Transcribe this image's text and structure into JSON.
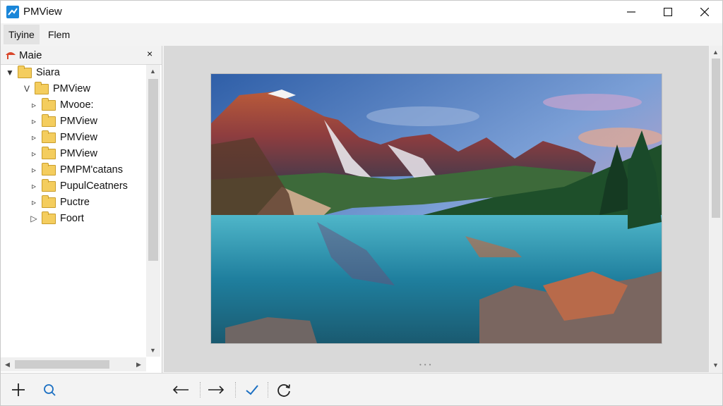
{
  "window": {
    "title": "PMView"
  },
  "menu": {
    "items": [
      "Tiyine",
      "Flem"
    ]
  },
  "panel": {
    "title": "Maie",
    "close": "×"
  },
  "tree": [
    {
      "label": "Siara",
      "toggle": "▼"
    },
    {
      "label": "PMView",
      "toggle": "V"
    },
    {
      "label": "Mvooe:",
      "toggle": "▹"
    },
    {
      "label": "PMView",
      "toggle": "▹"
    },
    {
      "label": "PMView",
      "toggle": "▹"
    },
    {
      "label": "PMView",
      "toggle": "▹"
    },
    {
      "label": "PMPM'catans",
      "toggle": "▹"
    },
    {
      "label": "PupulCeatners",
      "toggle": "▹"
    },
    {
      "label": "Puctre",
      "toggle": "▹"
    },
    {
      "label": "Foort",
      "toggle": "▷"
    }
  ],
  "viewer": {
    "dots": "•••"
  },
  "icons": {
    "app": "app-icon",
    "minimize": "minimize-icon",
    "maximize": "maximize-icon",
    "close": "close-icon",
    "panel": "panel-icon",
    "add": "plus-icon",
    "search": "search-icon",
    "back": "arrow-left-icon",
    "forward": "arrow-right-icon",
    "confirm": "checkmark-icon",
    "rotate": "rotate-icon"
  },
  "colors": {
    "accent": "#1a86d9",
    "folder": "#f4cd5e",
    "viewer_bg": "#d9d9d9"
  }
}
